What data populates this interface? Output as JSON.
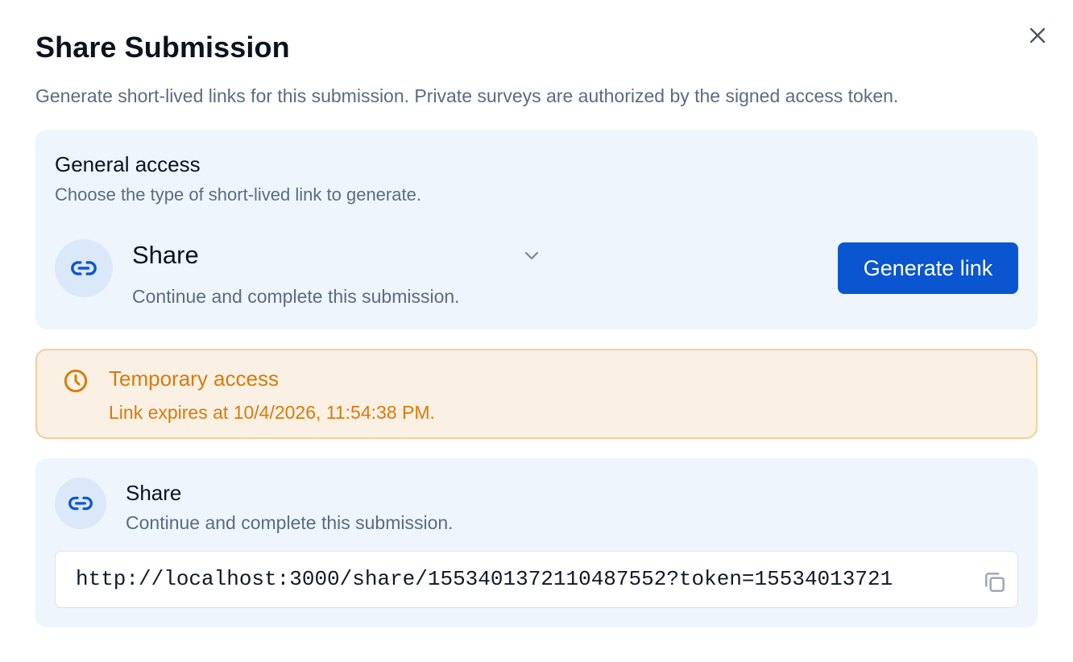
{
  "dialog": {
    "title": "Share Submission",
    "subtitle": "Generate short-lived links for this submission. Private surveys are authorized by the signed access token.",
    "close_icon": "close-icon"
  },
  "general_access": {
    "title": "General access",
    "description": "Choose the type of short-lived link to generate.",
    "icon": "link-icon",
    "select": {
      "value": "Share",
      "description": "Continue and complete this submission.",
      "icon": "chevron-down-icon"
    },
    "generate_button": "Generate link"
  },
  "temporary_access": {
    "icon": "clock-icon",
    "title": "Temporary access",
    "message": "Link expires at 10/4/2026, 11:54:38 PM."
  },
  "generated_link": {
    "icon": "link-icon",
    "title": "Share",
    "description": "Continue and complete this submission.",
    "url": "http://localhost:3000/share/15534013721104875​52?token=15534013721",
    "copy_icon": "copy-icon"
  },
  "colors": {
    "primary": "#0a56d0",
    "card_bg": "#eef5fd",
    "warning_text": "#d97a0a",
    "warning_bg": "#fbf0e4",
    "warning_border": "#f3cf9f",
    "muted_text": "#5b6b82"
  }
}
